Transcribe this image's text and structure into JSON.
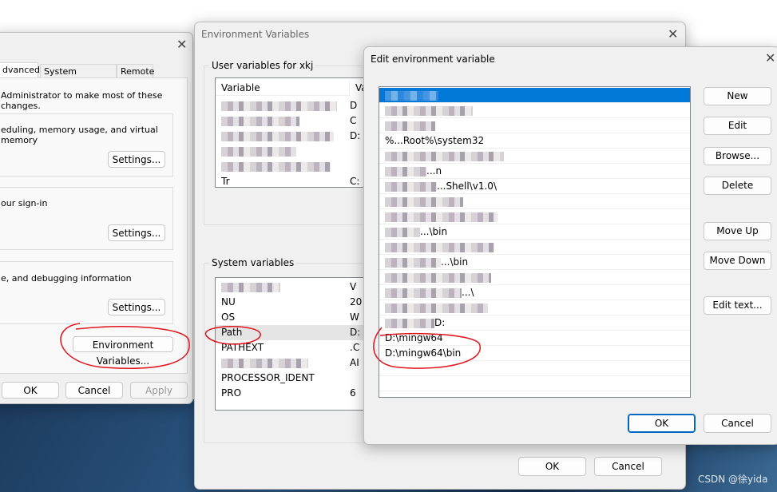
{
  "system_properties": {
    "tabs": [
      {
        "label": "dvanced",
        "selected": true
      },
      {
        "label": "System Protection"
      },
      {
        "label": "Remote"
      }
    ],
    "admin_note": "Administrator to make most of these changes.",
    "performance_text": "eduling, memory usage, and virtual memory",
    "profiles_text": "our sign-in",
    "startup_text": "e, and debugging information",
    "settings_label": "Settings...",
    "env_button": "Environment Variables...",
    "ok": "OK",
    "cancel": "Cancel",
    "apply": "Apply"
  },
  "env_dialog": {
    "title": "Environment Variables",
    "user_group": "User variables for xkj",
    "col_variable": "Variable",
    "col_value": "Va",
    "user_rows": [
      {
        "name": "",
        "value": "D"
      },
      {
        "name": "",
        "value": "C"
      },
      {
        "name": "",
        "value": "D:"
      },
      {
        "name": "",
        "value": ""
      },
      {
        "name": "",
        "value": ""
      },
      {
        "name": "Tr",
        "value": "C:"
      }
    ],
    "system_group": "System variables",
    "system_rows": [
      {
        "name": "",
        "value": "V"
      },
      {
        "name": "NU",
        "value": "20"
      },
      {
        "name": "OS",
        "value": "W"
      },
      {
        "name": "Path",
        "value": "D:",
        "selected": true
      },
      {
        "name": "PATHEXT",
        "value": ".C"
      },
      {
        "name": "",
        "value": "AI"
      },
      {
        "name": "PROCESSOR_IDENT",
        "value": ""
      },
      {
        "name": "PRO",
        "value": "6"
      }
    ],
    "ok": "OK",
    "cancel": "Cancel"
  },
  "edit_dialog": {
    "title": "Edit environment variable",
    "entries": [
      "",
      "",
      "",
      "%...Root%\\system32",
      "",
      "...n",
      "...Shell\\v1.0\\",
      "",
      "",
      "...\\bin",
      "",
      "...\\bin",
      "",
      "...\\",
      "",
      "D:",
      "D:\\mingw64",
      "D:\\mingw64\\bin"
    ],
    "selected_index": 0,
    "buttons": {
      "new": "New",
      "edit": "Edit",
      "browse": "Browse...",
      "delete": "Delete",
      "move_up": "Move Up",
      "move_down": "Move Down",
      "edit_text": "Edit text..."
    },
    "ok": "OK",
    "cancel": "Cancel",
    "accent": "#0078d7"
  },
  "watermark": "CSDN @徐yida",
  "annotation_color": "#e0141e"
}
